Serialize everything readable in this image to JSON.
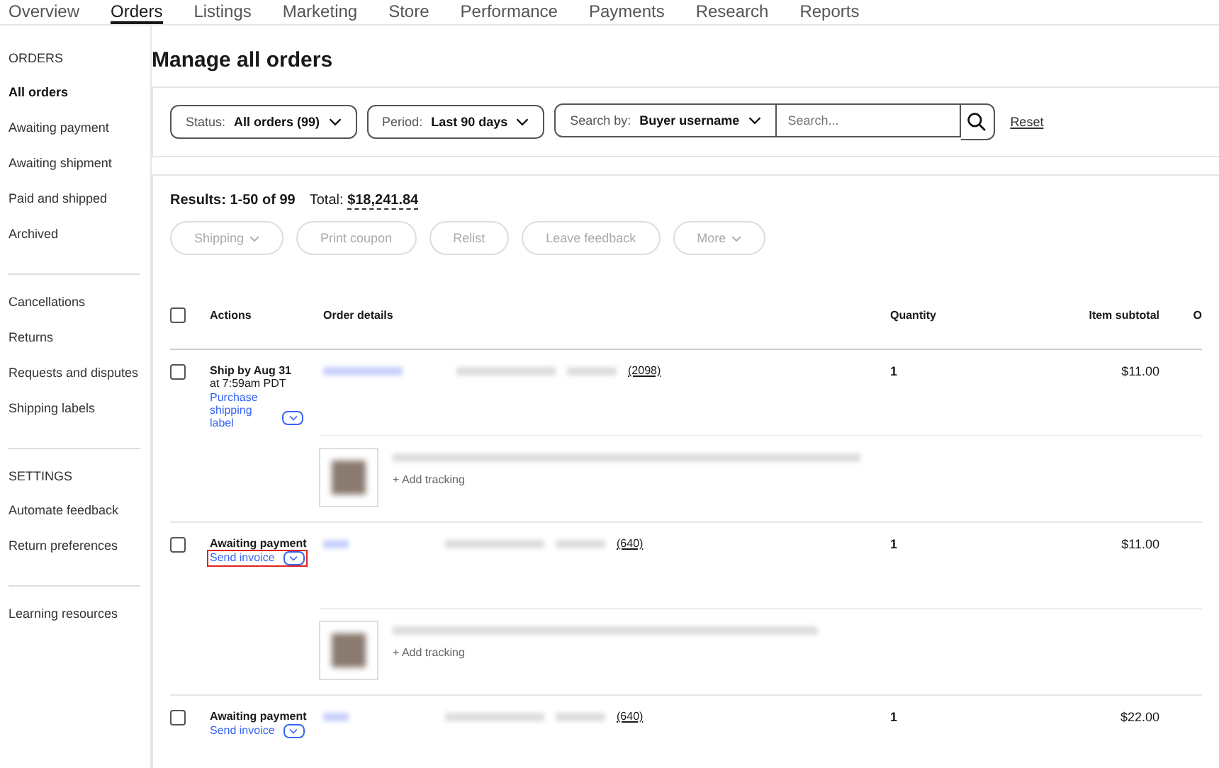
{
  "tabs": [
    {
      "label": "Overview",
      "selected": false
    },
    {
      "label": "Orders",
      "selected": true
    },
    {
      "label": "Listings",
      "selected": false
    },
    {
      "label": "Marketing",
      "selected": false
    },
    {
      "label": "Store",
      "selected": false
    },
    {
      "label": "Performance",
      "selected": false
    },
    {
      "label": "Payments",
      "selected": false
    },
    {
      "label": "Research",
      "selected": false
    },
    {
      "label": "Reports",
      "selected": false
    }
  ],
  "sidebar": {
    "sections": [
      {
        "heading": "ORDERS",
        "items": [
          {
            "label": "All orders",
            "selected": true
          },
          {
            "label": "Awaiting payment",
            "selected": false
          },
          {
            "label": "Awaiting shipment",
            "selected": false
          },
          {
            "label": "Paid and shipped",
            "selected": false
          },
          {
            "label": "Archived",
            "selected": false
          }
        ]
      },
      {
        "items": [
          {
            "label": "Cancellations",
            "selected": false
          },
          {
            "label": "Returns",
            "selected": false
          },
          {
            "label": "Requests and disputes",
            "selected": false
          },
          {
            "label": "Shipping labels",
            "selected": false
          }
        ]
      },
      {
        "heading": "SETTINGS",
        "items": [
          {
            "label": "Automate feedback",
            "selected": false
          },
          {
            "label": "Return preferences",
            "selected": false
          }
        ]
      },
      {
        "items": [
          {
            "label": "Learning resources",
            "selected": false
          }
        ]
      }
    ]
  },
  "page_title": "Manage all orders",
  "filters": {
    "status": {
      "label": "Status:",
      "value": "All orders (99)"
    },
    "period": {
      "label": "Period:",
      "value": "Last 90 days"
    },
    "search_by": {
      "label": "Search by:",
      "value": "Buyer username"
    },
    "search": {
      "placeholder": "Search..."
    },
    "reset": "Reset"
  },
  "results": {
    "summary": "Results: 1-50 of 99",
    "total_label": "Total:",
    "total": "$18,241.84"
  },
  "bulk_actions": [
    {
      "label": "Shipping",
      "dropdown": true,
      "disabled": true
    },
    {
      "label": "Print coupon",
      "dropdown": false,
      "disabled": true
    },
    {
      "label": "Relist",
      "dropdown": false,
      "disabled": true
    },
    {
      "label": "Leave feedback",
      "dropdown": false,
      "disabled": true
    },
    {
      "label": "More",
      "dropdown": true,
      "disabled": true
    }
  ],
  "table": {
    "select_all_checked": false,
    "columns": [
      "Actions",
      "Order details",
      "Quantity",
      "Item subtotal",
      "O"
    ],
    "orders": [
      {
        "checked": false,
        "status": "Ship by Aug 31",
        "status_detail": "at 7:59am PDT",
        "action": "Purchase shipping label",
        "highlighted": false,
        "feedback": "(2098)",
        "quantity": "1",
        "subtotal": "$11.00",
        "add_tracking": "+ Add tracking"
      },
      {
        "checked": false,
        "status": "Awaiting payment",
        "action": "Send invoice",
        "highlighted": true,
        "feedback": "(640)",
        "quantity": "1",
        "subtotal": "$11.00",
        "add_tracking": "+ Add tracking"
      },
      {
        "checked": false,
        "status": "Awaiting payment",
        "action": "Send invoice",
        "highlighted": false,
        "feedback": "(640)",
        "quantity": "1",
        "subtotal": "$22.00"
      }
    ]
  }
}
